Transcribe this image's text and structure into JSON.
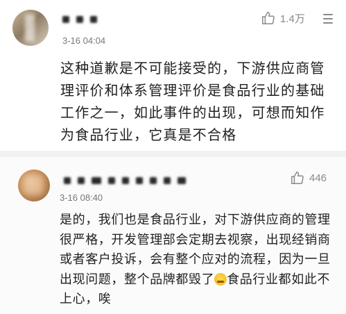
{
  "comments": [
    {
      "username_masked": "███ ██",
      "time": "3-16 04:04",
      "likes": "1.4万",
      "text": "这种道歉是不可能接受的，下游供应商管理评价和体系管理评价是食品行业的基础工作之一，如此事件的出现，可想而知作为食品行业，它真是不合格"
    },
    {
      "username_masked": "████ ██████",
      "time": "3-16 08:40",
      "likes": "446",
      "text_before_emoji": "是的，我们也是食品行业，对下游供应商的管理很严格，开发管理部会定期去视察，出现经销商或者客户投诉，会有整个应对的流程，因为一旦出现问题，整个品牌都毁了",
      "emoji": "crying-face-emoji",
      "text_after_emoji": "食品行业都如此不上心，唉"
    }
  ],
  "icons": {
    "like": "thumbs-up-icon",
    "more": "more-menu-icon"
  },
  "colors": {
    "meta_text": "#777777",
    "body_text": "#1f1f1f",
    "background": "#f2f2f2"
  }
}
